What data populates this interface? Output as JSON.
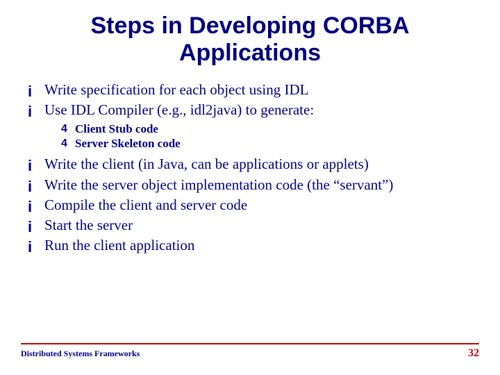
{
  "title": "Steps in Developing CORBA Applications",
  "items": [
    {
      "text": "Write specification for each object using IDL",
      "sub": []
    },
    {
      "text": "Use IDL Compiler (e.g., idl2java) to generate:",
      "sub": [
        "Client Stub code",
        "Server Skeleton code"
      ]
    },
    {
      "text": "Write the client (in Java, can be applications or applets)",
      "sub": []
    },
    {
      "text": "Write the server object implementation code (the “servant”)",
      "sub": []
    },
    {
      "text": "Compile the client and server code",
      "sub": []
    },
    {
      "text": "Start the server",
      "sub": []
    },
    {
      "text": "Run the client application",
      "sub": []
    }
  ],
  "footer": {
    "left": "Distributed Systems Frameworks",
    "page": "32"
  },
  "glyphs": {
    "main_bullet": "i",
    "sub_bullet": "4"
  }
}
